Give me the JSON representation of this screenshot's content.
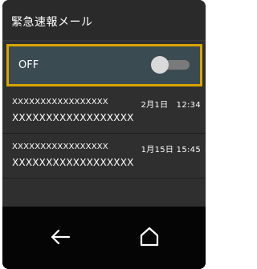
{
  "header": {
    "title": "緊急速報メール"
  },
  "toggle": {
    "label": "OFF",
    "state": "off"
  },
  "messages": [
    {
      "sender": "XXXXXXXXXXXXXXXXX",
      "date": "2月1日　12:34",
      "subject": "XXXXXXXXXXXXXXXXXX"
    },
    {
      "sender": "XXXXXXXXXXXXXXXXX",
      "date": "1月15日 15:45",
      "subject": "XXXXXXXXXXXXXXXXXX"
    }
  ],
  "navbar": {
    "back_icon": "back-arrow-icon",
    "home_icon": "home-icon"
  },
  "colors": {
    "highlight": "#d9a400",
    "toggle_row_bg": "#3b4b52",
    "screen_bg": "#2f2f2f",
    "navbar_bg": "#050505"
  }
}
